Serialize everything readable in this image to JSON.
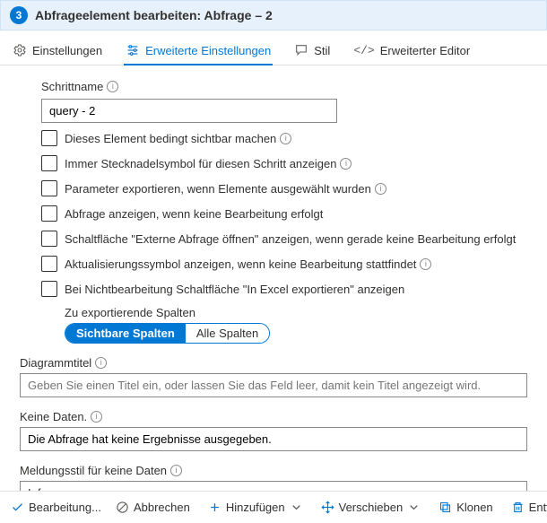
{
  "header": {
    "badge": "3",
    "title": "Abfrageelement bearbeiten: Abfrage – 2"
  },
  "tabs": {
    "settings": "Einstellungen",
    "advanced": "Erweiterte Einstellungen",
    "style": "Stil",
    "editor": "Erweiterter Editor"
  },
  "form": {
    "stepname_label": "Schrittname",
    "stepname_value": "query - 2",
    "checks": {
      "c1": "Dieses Element bedingt sichtbar machen",
      "c2": "Immer Stecknadelsymbol für diesen Schritt anzeigen",
      "c3": "Parameter exportieren, wenn Elemente ausgewählt wurden",
      "c4": "Abfrage anzeigen, wenn keine Bearbeitung erfolgt",
      "c5": "Schaltfläche \"Externe Abfrage öffnen\" anzeigen, wenn gerade keine Bearbeitung erfolgt",
      "c6": "Aktualisierungssymbol anzeigen, wenn keine Bearbeitung stattfindet",
      "c7": "Bei Nichtbearbeitung Schaltfläche \"In Excel exportieren\" anzeigen"
    },
    "export_cols_label": "Zu exportierende Spalten",
    "pills": {
      "visible": "Sichtbare Spalten",
      "all": "Alle Spalten"
    },
    "chart_title_label": "Diagrammtitel",
    "chart_title_placeholder": "Geben Sie einen Titel ein, oder lassen Sie das Feld leer, damit kein Titel angezeigt wird.",
    "nodata_label": "Keine Daten.",
    "nodata_value": "Die Abfrage hat keine Ergebnisse ausgegeben.",
    "nodata_style_label": "Meldungsstil für keine Daten",
    "nodata_style_value": "Info"
  },
  "footer": {
    "done": "Bearbeitung...",
    "cancel": "Abbrechen",
    "add": "Hinzufügen",
    "move": "Verschieben",
    "clone": "Klonen",
    "remove": "Entfernen"
  }
}
